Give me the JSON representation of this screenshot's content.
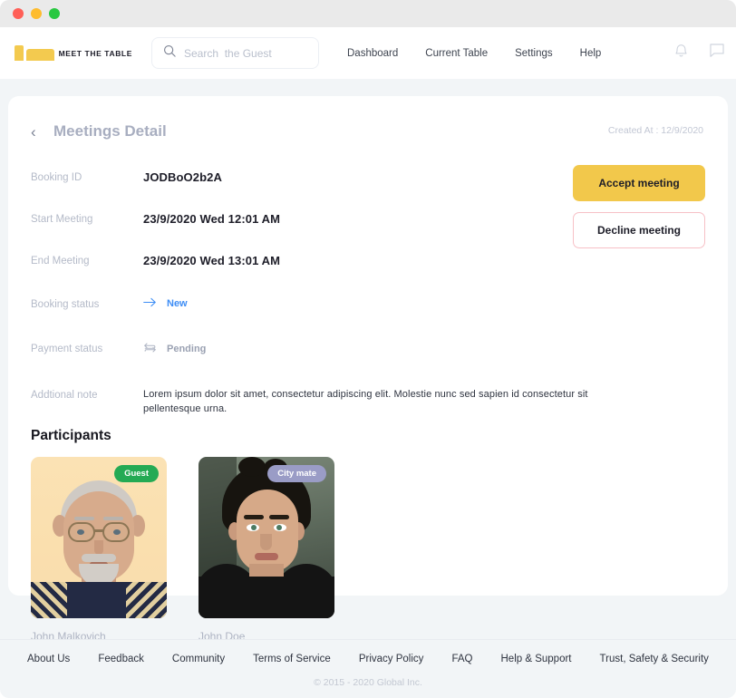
{
  "window": {
    "traffic_lights": [
      "close",
      "minimize",
      "maximize"
    ]
  },
  "topnav": {
    "brand": "MEET THE TABLE",
    "search": {
      "placeholder": "Search  the Guest",
      "value": "",
      "icon": "search-icon"
    },
    "links": [
      {
        "label": "Dashboard"
      },
      {
        "label": "Current Table"
      },
      {
        "label": "Settings"
      },
      {
        "label": "Help"
      }
    ],
    "icons": [
      {
        "name": "bell-icon"
      },
      {
        "name": "chat-icon"
      }
    ]
  },
  "page": {
    "back_icon": "chevron-left-icon",
    "title": "Meetings Detail",
    "created_at": "Created At : 12/9/2020"
  },
  "details": [
    {
      "label": "Booking ID",
      "value": "JODBoO2b2A"
    },
    {
      "label": "Start Meeting",
      "value": "23/9/2020 Wed 12:01 AM"
    },
    {
      "label": "End Meeting",
      "value": "23/9/2020 Wed 13:01 AM"
    },
    {
      "label": "Booking status",
      "value": "New",
      "icon": "arrow-right-icon",
      "color": "#3d8df5"
    },
    {
      "label": "Payment status",
      "value": "Pending",
      "icon": "cycle-icon",
      "color": "#9aa1b2"
    },
    {
      "label": "Addtional note",
      "value": "Lorem ipsum dolor sit amet, consectetur adipiscing elit. Molestie nunc sed sapien id consectetur sit pellentesque urna."
    }
  ],
  "actions": {
    "accept_label": "Accept meeting",
    "accept_color": "#f2c84b",
    "decline_label": "Decline meeting",
    "decline_border_color": "#f7c0c6"
  },
  "participants_section": {
    "title": "Participants",
    "people": [
      {
        "name": "John Malkovich",
        "badge": "Guest",
        "badge_color": "#24aa54"
      },
      {
        "name": "John Doe",
        "badge": "City mate",
        "badge_color": "#9a9cc6"
      }
    ]
  },
  "footer": {
    "links": [
      {
        "label": "About Us"
      },
      {
        "label": "Feedback"
      },
      {
        "label": "Community"
      },
      {
        "label": "Terms of Service"
      },
      {
        "label": "Privacy Policy"
      },
      {
        "label": "FAQ"
      },
      {
        "label": "Help & Support"
      },
      {
        "label": "Trust, Safety & Security"
      }
    ],
    "copyright": "© 2015 - 2020 Global Inc."
  }
}
